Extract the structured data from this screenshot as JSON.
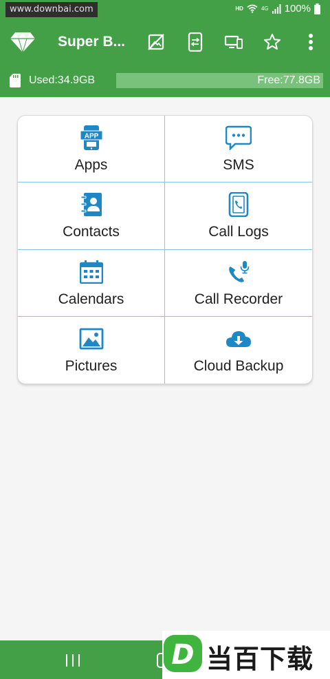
{
  "status_bar": {
    "watermark": "www.downbai.com",
    "hd": "HD",
    "network": "4G",
    "battery": "100%",
    "icons": [
      "wifi-icon",
      "signal-icon",
      "battery-icon"
    ]
  },
  "app_bar": {
    "title": "Super B...",
    "logo": "diamond-icon",
    "actions": [
      "no-image-icon",
      "phone-transfer-icon",
      "devices-icon",
      "star-icon",
      "more-vert-icon"
    ]
  },
  "storage": {
    "used_label": "Used:34.9GB",
    "free_label": "Free:77.8GB",
    "used_fraction": 0.31
  },
  "grid": {
    "items": [
      {
        "label": "Apps",
        "icon": "apps-icon"
      },
      {
        "label": "SMS",
        "icon": "sms-icon"
      },
      {
        "label": "Contacts",
        "icon": "contacts-icon"
      },
      {
        "label": "Call Logs",
        "icon": "call-logs-icon"
      },
      {
        "label": "Calendars",
        "icon": "calendar-icon"
      },
      {
        "label": "Call Recorder",
        "icon": "call-recorder-icon"
      },
      {
        "label": "Pictures",
        "icon": "pictures-icon"
      },
      {
        "label": "Cloud Backup",
        "icon": "cloud-backup-icon"
      }
    ],
    "apps_badge": "APP"
  },
  "nav_bar": {
    "icons": [
      "recent-apps-icon",
      "home-icon"
    ]
  },
  "corner_watermark": {
    "text": "当百下载",
    "logo_letter": "D"
  },
  "colors": {
    "primary": "#43a047",
    "storage_free": "#79c27c",
    "icon_blue": "#1e88c7",
    "divider": "#7fc6e8"
  }
}
